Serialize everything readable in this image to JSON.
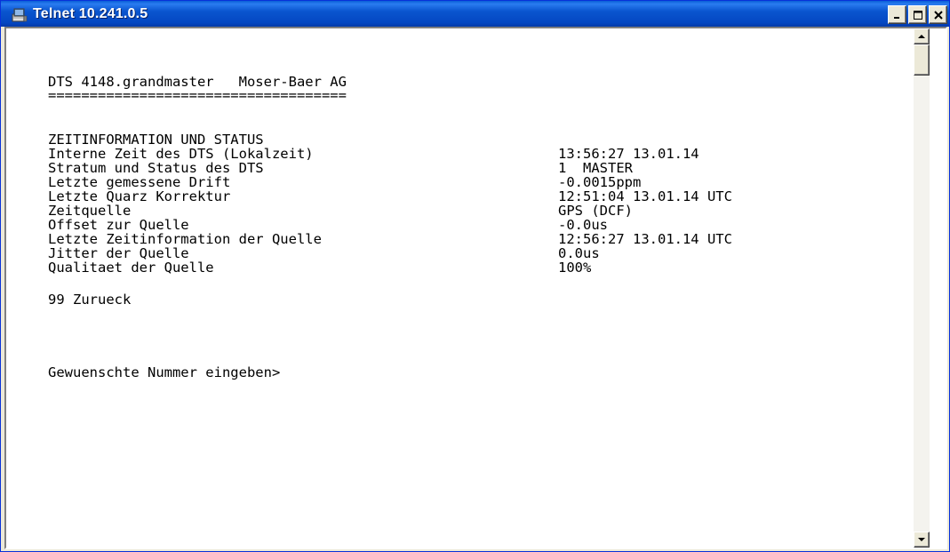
{
  "window": {
    "title": "Telnet 10.241.0.5",
    "controls": {
      "minimize": "_",
      "maximize": "□",
      "close": "×"
    }
  },
  "terminal": {
    "header": "DTS 4148.grandmaster   Moser-Baer AG",
    "separator": "====================================",
    "section_title": "ZEITINFORMATION UND STATUS",
    "rows": [
      {
        "label": "Interne Zeit des DTS (Lokalzeit)",
        "value": "13:56:27 13.01.14"
      },
      {
        "label": "Stratum und Status des DTS",
        "value": "1  MASTER"
      },
      {
        "label": "Letzte gemessene Drift",
        "value": "-0.0015ppm"
      },
      {
        "label": "Letzte Quarz Korrektur",
        "value": "12:51:04 13.01.14 UTC"
      },
      {
        "label": "Zeitquelle",
        "value": "GPS (DCF)"
      },
      {
        "label": "Offset zur Quelle",
        "value": "-0.0us"
      },
      {
        "label": "Letzte Zeitinformation der Quelle",
        "value": "12:56:27 13.01.14 UTC"
      },
      {
        "label": "Jitter der Quelle",
        "value": "0.0us"
      },
      {
        "label": "Qualitaet der Quelle",
        "value": "100%"
      }
    ],
    "menu_back": "99 Zurueck",
    "prompt": "Gewuenschte Nummer eingeben>"
  },
  "colors": {
    "titlebar": "#0a55cf",
    "terminal_bg": "#ffffff",
    "terminal_fg": "#000000"
  },
  "icons": {
    "title_icon": "telnet-terminal-icon",
    "scroll_up": "arrow-up-icon",
    "scroll_down": "arrow-down-icon"
  }
}
